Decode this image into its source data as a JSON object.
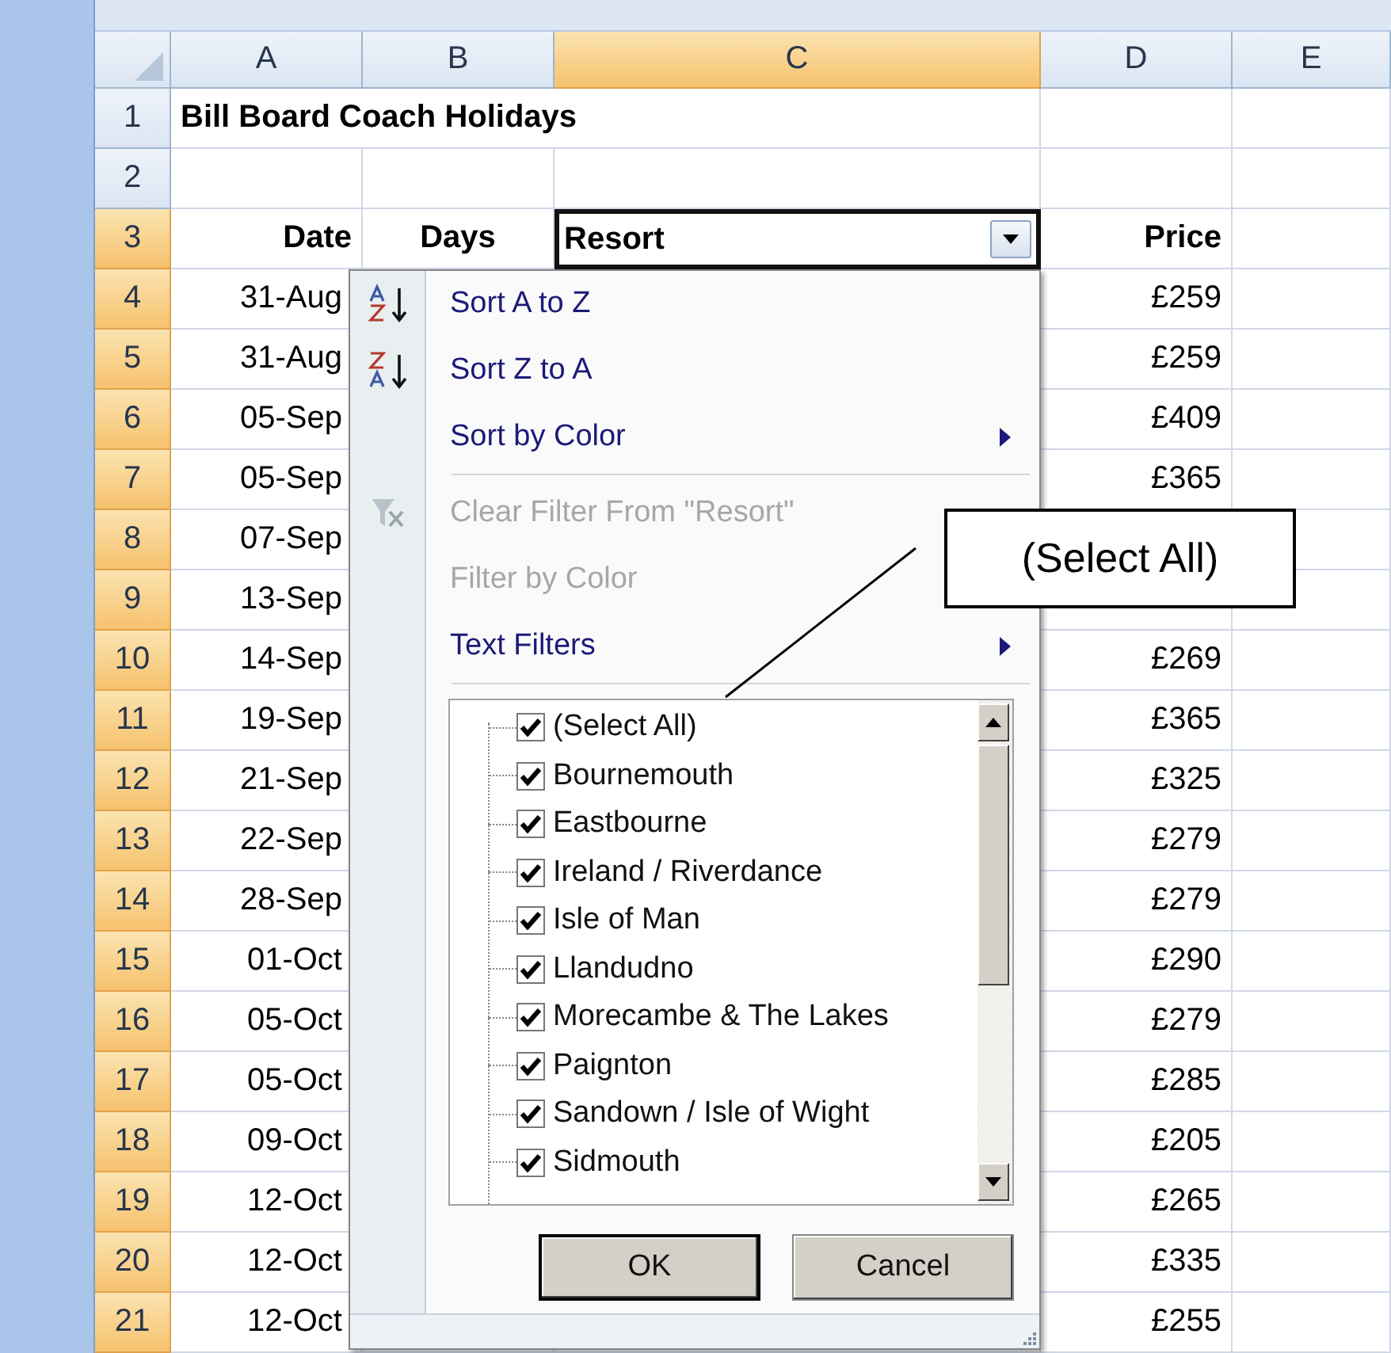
{
  "columns": [
    {
      "label": "A",
      "selected": false
    },
    {
      "label": "B",
      "selected": false
    },
    {
      "label": "C",
      "selected": true
    },
    {
      "label": "D",
      "selected": false
    },
    {
      "label": "E",
      "selected": false
    }
  ],
  "rows": [
    {
      "number": "1",
      "selected": false,
      "kind": "title",
      "title": "Bill Board Coach Holidays"
    },
    {
      "number": "2",
      "selected": false,
      "kind": "blank"
    },
    {
      "number": "3",
      "selected": true,
      "kind": "header",
      "date": "Date",
      "days": "Days",
      "resort": "Resort",
      "price": "Price"
    },
    {
      "number": "4",
      "selected": true,
      "kind": "data",
      "date": "31-Aug",
      "price": "£259"
    },
    {
      "number": "5",
      "selected": true,
      "kind": "data",
      "date": "31-Aug",
      "price": "£259"
    },
    {
      "number": "6",
      "selected": true,
      "kind": "data",
      "date": "05-Sep",
      "price": "£409"
    },
    {
      "number": "7",
      "selected": true,
      "kind": "data",
      "date": "05-Sep",
      "price": "£365"
    },
    {
      "number": "8",
      "selected": true,
      "kind": "data",
      "date": "07-Sep"
    },
    {
      "number": "9",
      "selected": true,
      "kind": "data",
      "date": "13-Sep"
    },
    {
      "number": "10",
      "selected": true,
      "kind": "data",
      "date": "14-Sep",
      "price": "£269"
    },
    {
      "number": "11",
      "selected": true,
      "kind": "data",
      "date": "19-Sep",
      "price": "£365"
    },
    {
      "number": "12",
      "selected": true,
      "kind": "data",
      "date": "21-Sep",
      "price": "£325"
    },
    {
      "number": "13",
      "selected": true,
      "kind": "data",
      "date": "22-Sep",
      "price": "£279"
    },
    {
      "number": "14",
      "selected": true,
      "kind": "data",
      "date": "28-Sep",
      "price": "£279"
    },
    {
      "number": "15",
      "selected": true,
      "kind": "data",
      "date": "01-Oct",
      "price": "£290"
    },
    {
      "number": "16",
      "selected": true,
      "kind": "data",
      "date": "05-Oct",
      "price": "£279"
    },
    {
      "number": "17",
      "selected": true,
      "kind": "data",
      "date": "05-Oct",
      "price": "£285"
    },
    {
      "number": "18",
      "selected": true,
      "kind": "data",
      "date": "09-Oct",
      "price": "£205"
    },
    {
      "number": "19",
      "selected": true,
      "kind": "data",
      "date": "12-Oct",
      "price": "£265"
    },
    {
      "number": "20",
      "selected": true,
      "kind": "data",
      "date": "12-Oct",
      "price": "£335"
    },
    {
      "number": "21",
      "selected": true,
      "kind": "data",
      "date": "12-Oct",
      "price": "£255"
    }
  ],
  "filter_menu": {
    "items": [
      {
        "kind": "sort_ascending",
        "label": "Sort A to Z",
        "disabled": false,
        "submenu": false
      },
      {
        "kind": "sort_descending",
        "label": "Sort Z to A",
        "disabled": false,
        "submenu": false
      },
      {
        "kind": "command",
        "label": "Sort by Color",
        "disabled": false,
        "submenu": true
      },
      {
        "kind": "separator"
      },
      {
        "kind": "clear_filter",
        "label": "Clear Filter From \"Resort\"",
        "disabled": true,
        "submenu": false
      },
      {
        "kind": "command",
        "label": "Filter by Color",
        "disabled": true,
        "submenu": false
      },
      {
        "kind": "command",
        "label": "Text Filters",
        "disabled": false,
        "submenu": true
      },
      {
        "kind": "separator"
      }
    ],
    "values": [
      {
        "label": "(Select All)",
        "checked": true
      },
      {
        "label": "Bournemouth",
        "checked": true
      },
      {
        "label": "Eastbourne",
        "checked": true
      },
      {
        "label": "Ireland / Riverdance",
        "checked": true
      },
      {
        "label": "Isle of Man",
        "checked": true
      },
      {
        "label": "Llandudno",
        "checked": true
      },
      {
        "label": "Morecambe & The Lakes",
        "checked": true
      },
      {
        "label": "Paignton",
        "checked": true
      },
      {
        "label": "Sandown / Isle of Wight",
        "checked": true
      },
      {
        "label": "Sidmouth",
        "checked": true
      }
    ],
    "buttons": [
      {
        "label": "OK",
        "default": true
      },
      {
        "label": "Cancel",
        "default": false
      }
    ]
  },
  "callout": {
    "text": "(Select All)"
  }
}
